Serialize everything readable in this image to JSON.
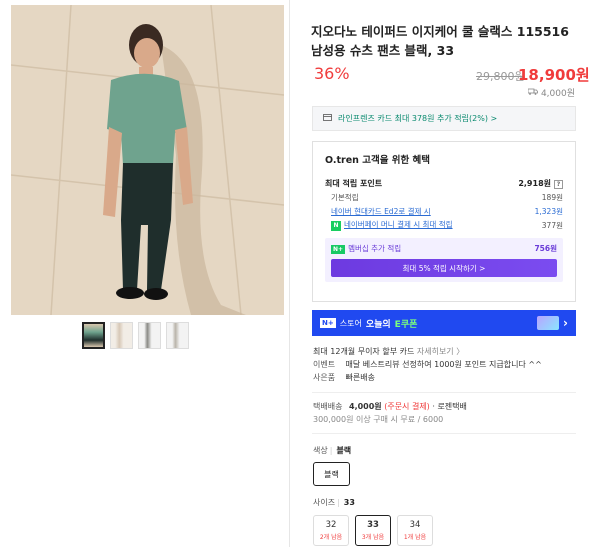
{
  "product": {
    "title": "지오다노 테이퍼드 이지케어 쿨 슬랙스 115516 남성용 슈츠 팬츠 블랙, 33",
    "discount": "36%",
    "original_price": "29,800원",
    "sale_price": "18,900원",
    "shipping_small": "4,000원"
  },
  "card_banner": {
    "text": "라인프렌즈 카드 최대 378원 추가 적립(2%) >"
  },
  "benefit": {
    "title": "O.tren 고객을 위한 혜택",
    "max_point_label": "최대 적립 포인트",
    "max_point_value": "2,918원",
    "help": "?",
    "rows": [
      {
        "label": "기본적립",
        "value": "189원"
      },
      {
        "label": "네이버 현대카드 Ed2로 결제 시",
        "value": "1,323원"
      },
      {
        "label": "네이버페이 머니 결제 시 최대 적립",
        "value": "377원"
      }
    ],
    "npay_badge": "N",
    "membership_badge": "N+",
    "membership_label": "멤버십 추가 적립",
    "membership_value": "756원",
    "membership_button": "최대 5% 적립 시작하기 >"
  },
  "coupon": {
    "badge": "N+",
    "text_prefix": "스토어",
    "text_main": "오늘의",
    "text_highlight": "E쿠폰",
    "chevron": "›"
  },
  "info": {
    "installment": "최대 12개월 무이자 할부 카드",
    "installment_link": "자세히보기 〉",
    "event_label": "이벤트",
    "event_text": "매달 베스트리뷰 선정하여 1000원 포인트 지급합니다 ^^",
    "gift_label": "사은품",
    "gift_text": "빠른배송"
  },
  "delivery": {
    "label": "택배배송",
    "price": "4,000원",
    "note": "(주문시 결제)",
    "carrier": "· 로젠택배",
    "condition": "300,000원 이상 구매 시 무료 / 6000"
  },
  "options": {
    "color_label": "색상",
    "color_selected": "블랙",
    "color_button": "블랙",
    "size_label": "사이즈",
    "size_selected": "33",
    "sizes": [
      {
        "value": "32",
        "stock": "2개 남음"
      },
      {
        "value": "33",
        "stock": "3개 남음"
      },
      {
        "value": "34",
        "stock": "1개 남음"
      }
    ]
  }
}
